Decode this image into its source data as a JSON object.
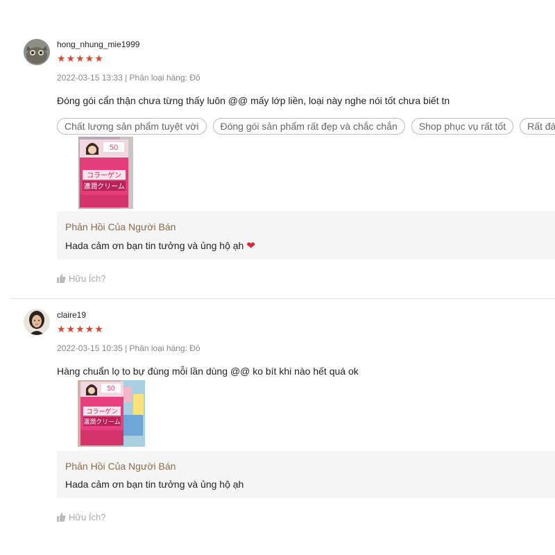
{
  "reviews": [
    {
      "username": "hong_nhung_mie1999",
      "stars": "★★★★★",
      "meta": "2022-03-15 13:33 | Phân loại hàng: Đỏ",
      "comment": "Đóng gói cẩn thận chưa từng thấy luôn @@ mấy lớp liền, loại này nghe nói tốt chưa biết tn",
      "tags": [
        "Chất lượng sản phẩm tuyệt vời",
        "Đóng gói sản phẩm rất đẹp và chắc chắn",
        "Shop phục vụ rất tốt",
        "Rất đáng"
      ],
      "photo_text": {
        "badge": "50",
        "line1": "コラーゲン",
        "line2": "濃潤クリーム"
      },
      "reply_title": "Phản Hồi Của Người Bán",
      "reply_text": "Hada cảm ơn bạn tin tưởng và ủng hộ ạh",
      "helpful": "Hữu Ích?"
    },
    {
      "username": "claire19",
      "stars": "★★★★★",
      "meta": "2022-03-15 10:35 | Phân loại hàng: Đỏ",
      "comment": "Hàng chuẩn lọ to bự đùng mỗi lần dùng @@ ko bít khi nào hết quá ok",
      "photo_text": {
        "badge": "50",
        "line1": "コラーゲン",
        "line2": "濃潤クリーム"
      },
      "reply_title": "Phản Hồi Của Người Bán",
      "reply_text": "Hada cảm ơn bạn tin tưởng và ủng hộ ạh",
      "helpful": "Hữu Ích?"
    }
  ],
  "colors": {
    "star": "#e0452b",
    "reply_title": "#8a6a4a",
    "reply_bg": "#f5f5f5"
  },
  "icons": {
    "helpful": "thumbs-up-icon",
    "reply_heart": "heart-icon"
  }
}
